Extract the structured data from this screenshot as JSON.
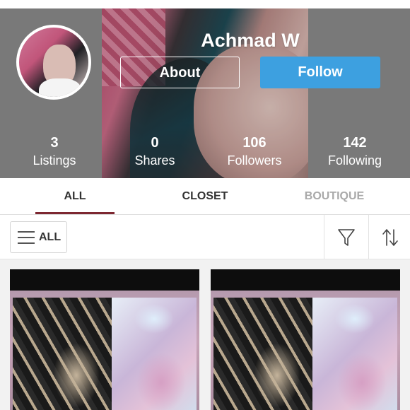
{
  "profile": {
    "username": "Achmad W",
    "about_label": "About",
    "follow_label": "Follow",
    "stats": [
      {
        "value": "3",
        "label": "Listings"
      },
      {
        "value": "0",
        "label": "Shares"
      },
      {
        "value": "106",
        "label": "Followers"
      },
      {
        "value": "142",
        "label": "Following"
      }
    ]
  },
  "tabs": [
    {
      "label": "ALL",
      "active": true
    },
    {
      "label": "CLOSET",
      "active": false
    },
    {
      "label": "BOUTIQUE",
      "active": false
    }
  ],
  "filter_bar": {
    "menu_icon": "hamburger-menu-icon",
    "all_label": "ALL",
    "filter_icon": "filter-funnel-icon",
    "sort_icon": "sort-arrows-icon"
  },
  "listings": [
    {
      "image": "tie-dye-shirts-photo"
    },
    {
      "image": "tie-dye-shirts-photo"
    }
  ],
  "colors": {
    "follow_button": "#3da0e0",
    "active_tab_underline": "#7d2731",
    "inactive_tab_text": "#a9a9a9",
    "header_background": "#8a8a8a"
  }
}
